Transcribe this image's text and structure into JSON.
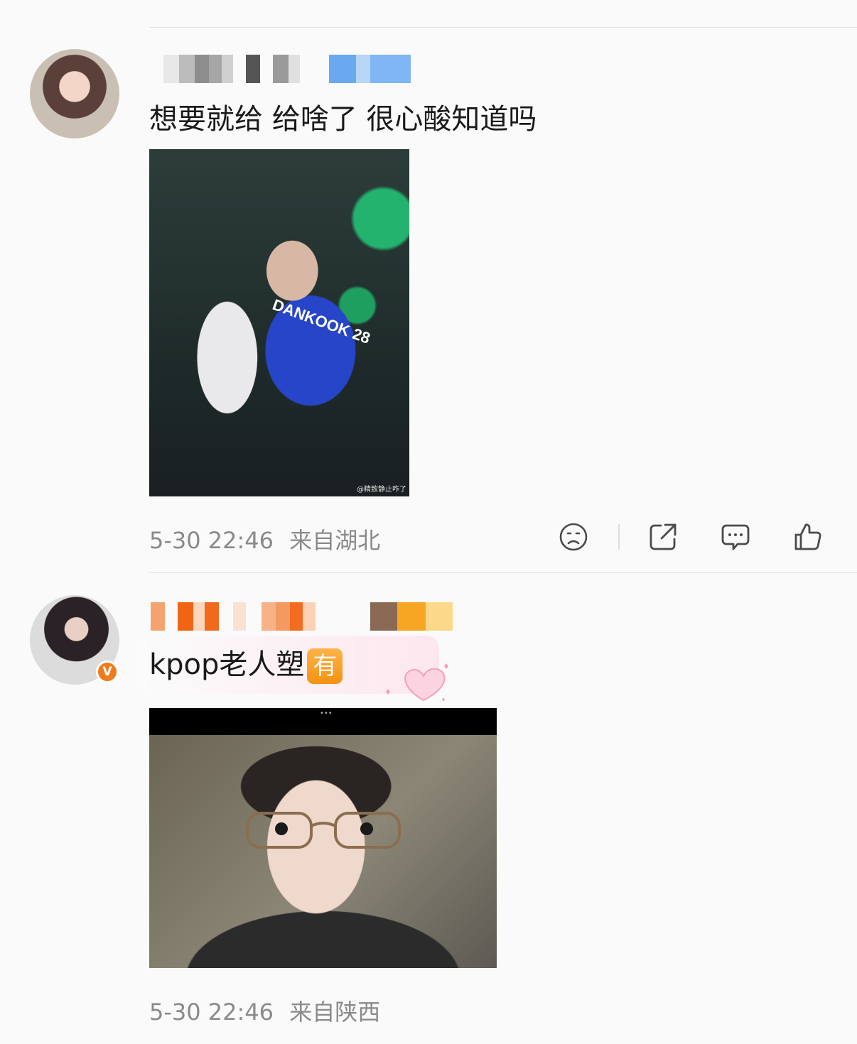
{
  "comments": [
    {
      "text": "想要就给 给啥了 很心酸知道吗",
      "time": "5-30 22:46",
      "location": "来自湖北",
      "image_watermark": "@精致静止咋了",
      "image_text": "DANKOOK 28",
      "actions": [
        "sad-face-icon",
        "share-icon",
        "comment-icon",
        "like-icon"
      ]
    },
    {
      "text": "kpop老人塑",
      "badge": "有",
      "verified_badge": "V",
      "time": "5-30 22:46",
      "location": "来自陕西",
      "image_dots": "•••"
    }
  ]
}
